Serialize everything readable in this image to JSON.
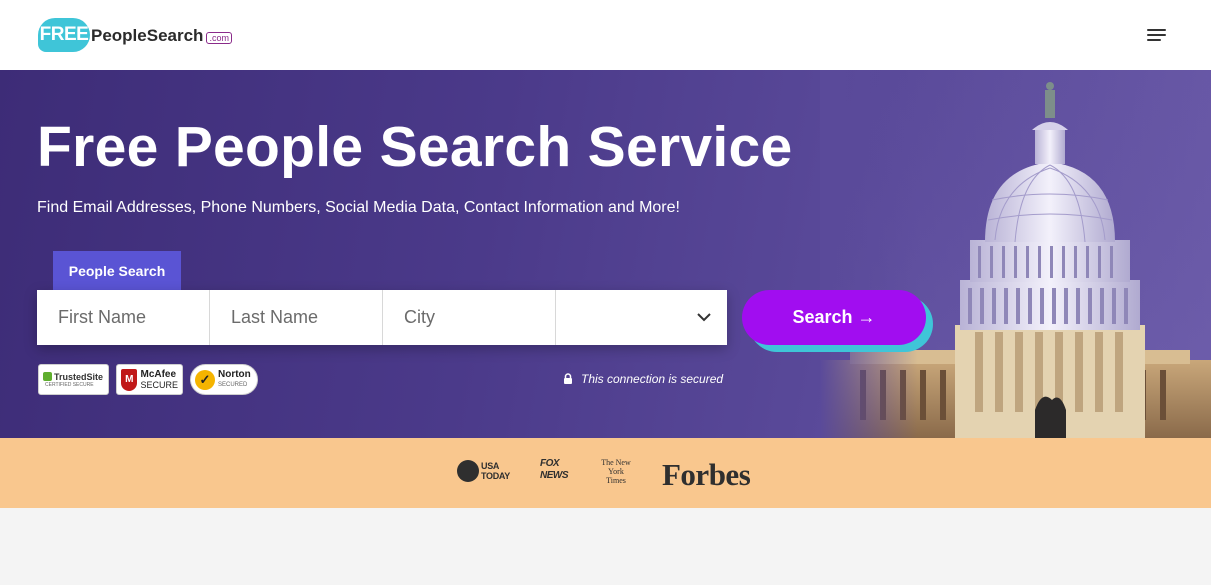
{
  "header": {
    "logo": {
      "free": "FREE",
      "name": "PeopleSearch",
      "tld": ".com"
    },
    "menu_icon": "hamburger-menu-icon"
  },
  "hero": {
    "title": "Free People Search Service",
    "subtitle": "Find Email Addresses, Phone Numbers, Social Media Data, Contact Information and More!",
    "tab_label": "People Search",
    "fields": {
      "first_name_placeholder": "First Name",
      "last_name_placeholder": "Last Name",
      "city_placeholder": "City",
      "state_value": ""
    },
    "search_button": "Search →",
    "secure_note": "This connection is secured",
    "badges": {
      "trusted": {
        "line1": "TrustedSite",
        "line2": "CERTIFIED SECURE"
      },
      "mcafee": {
        "line1": "McAfee",
        "line2": "SECURE"
      },
      "norton": {
        "line1": "Norton",
        "line2": "SECURED"
      }
    }
  },
  "press": {
    "usa_today": "USA TODAY",
    "fox_news": "FOX NEWS",
    "nyt": "The New York Times",
    "forbes": "Forbes"
  },
  "colors": {
    "tab": "#5a54d4",
    "search_button": "#a10df0",
    "search_shadow": "#3fc5d8",
    "press_band": "#f9c78e",
    "hero": "#4b3a8a"
  }
}
